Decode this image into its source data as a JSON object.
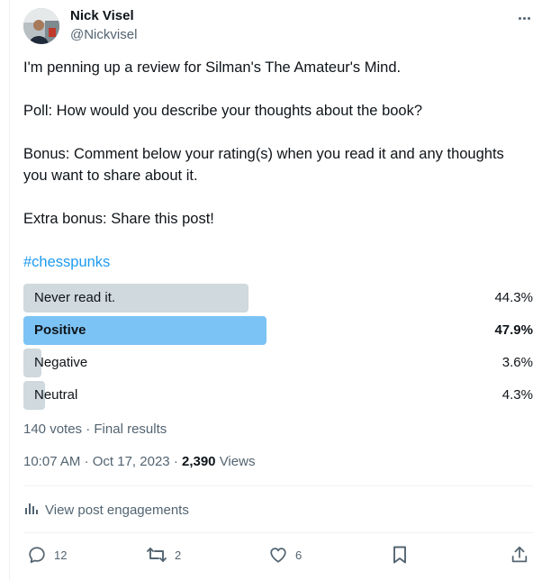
{
  "tweet": {
    "author": {
      "name": "Nick Visel",
      "handle": "@Nickvisel"
    },
    "lines": [
      "I'm penning up a review for Silman's The Amateur's Mind.",
      "Poll: How would you describe your thoughts about the book?",
      "Bonus: Comment below your rating(s) when you read it and any thoughts",
      "you want to share about it.",
      "Extra bonus: Share this post!"
    ],
    "hashtag": "#chesspunks"
  },
  "poll": {
    "options": [
      {
        "label": "Never read it.",
        "percent_text": "44.3%",
        "percent": 44.3,
        "winner": false
      },
      {
        "label": "Positive",
        "percent_text": "47.9%",
        "percent": 47.9,
        "winner": true
      },
      {
        "label": "Negative",
        "percent_text": "3.6%",
        "percent": 3.6,
        "winner": false
      },
      {
        "label": "Neutral",
        "percent_text": "4.3%",
        "percent": 4.3,
        "winner": false
      }
    ],
    "votes": "140 votes",
    "separator": "·",
    "status": "Final results"
  },
  "meta": {
    "time": "10:07 AM",
    "date": "Oct 17, 2023",
    "views_count": "2,390",
    "views_label": "Views"
  },
  "engagements_label": "View post engagements",
  "actions": {
    "replies": "12",
    "reposts": "2",
    "likes": "6"
  },
  "icons": [
    "more-icon",
    "analytics-icon",
    "reply-icon",
    "repost-icon",
    "like-icon",
    "bookmark-icon",
    "share-icon"
  ],
  "colors": {
    "link": "#1d9bf0",
    "winner_bar": "#7cc3f5",
    "bar": "#cfd9de",
    "muted": "#536471"
  }
}
